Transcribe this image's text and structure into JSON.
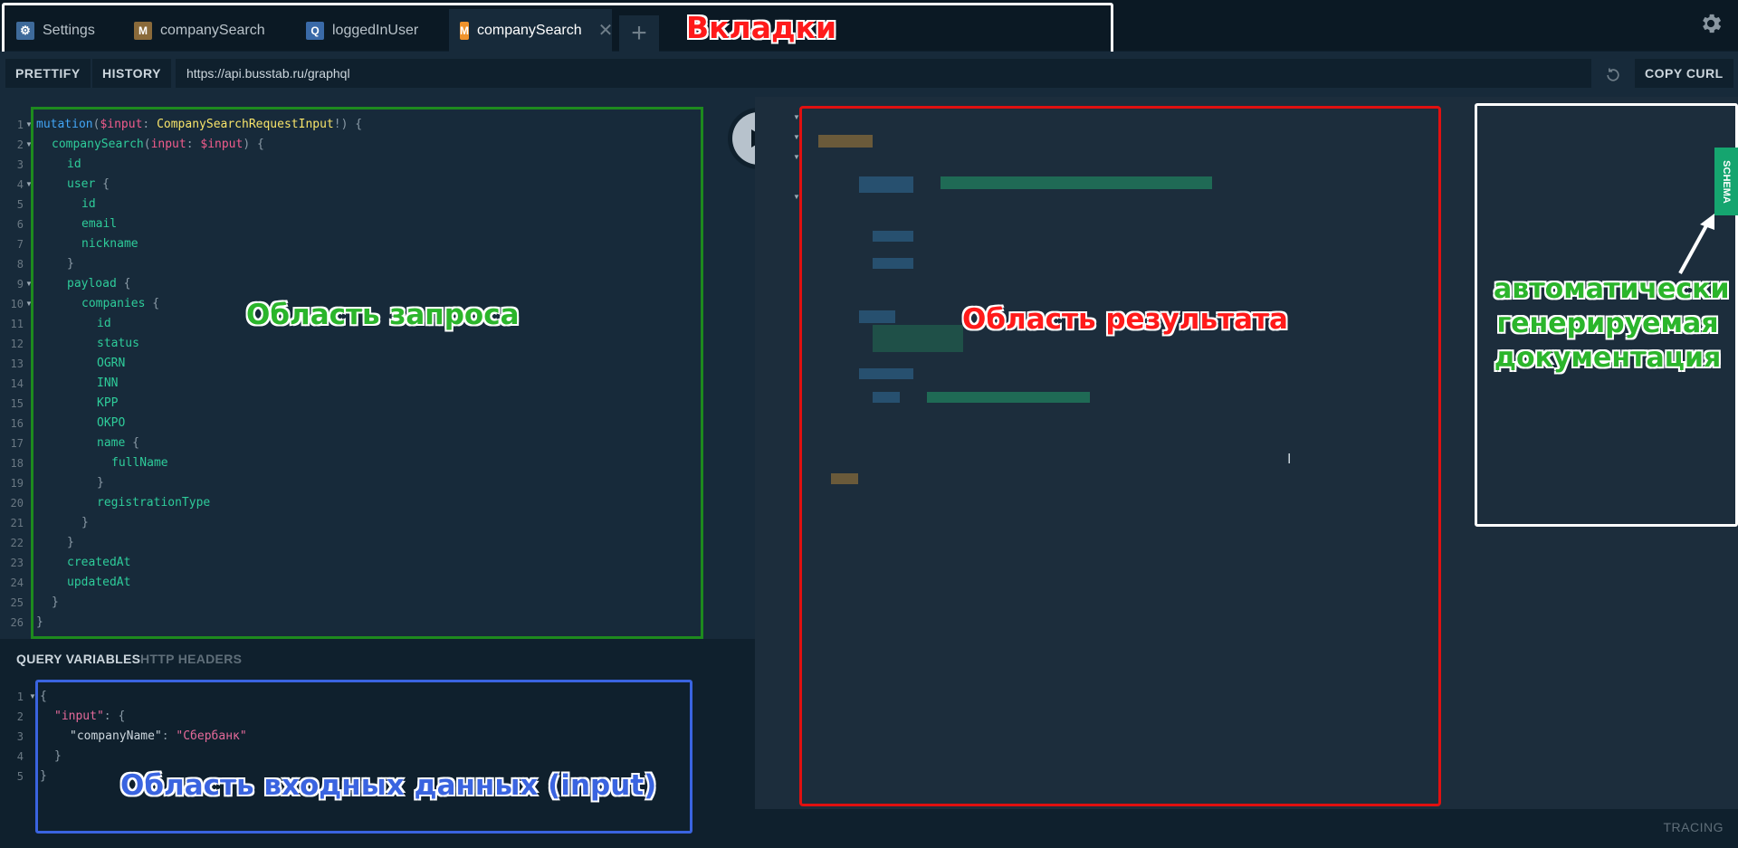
{
  "tabs": [
    {
      "badge": "⚙",
      "label": "Settings",
      "badge_color": "#3e6a9a"
    },
    {
      "badge": "M",
      "label": "companySearch",
      "badge_color": "#8a6a3a"
    },
    {
      "badge": "Q",
      "label": "loggedInUser",
      "badge_color": "#3a6aa8"
    },
    {
      "badge": "M",
      "label": "companySearch",
      "badge_color": "#f0932b",
      "close": "✕"
    }
  ],
  "add_tab": "+",
  "toolbar": {
    "prettify": "PRETTIFY",
    "history": "HISTORY",
    "url": "https://api.busstab.ru/graphql",
    "copy_curl": "COPY CURL"
  },
  "query_lines": [
    "1",
    "2",
    "3",
    "4",
    "5",
    "6",
    "7",
    "8",
    "9",
    "10",
    "11",
    "12",
    "13",
    "14",
    "15",
    "16",
    "17",
    "18",
    "19",
    "20",
    "21",
    "22",
    "23",
    "24",
    "25",
    "26"
  ],
  "query": {
    "l1_kw": "mutation",
    "l1_var": "$input",
    "l1_type": "CompanySearchRequestInput",
    "l2_field": "companySearch",
    "l2_arg": "input",
    "l2_var": "$input",
    "id": "id",
    "user": "user",
    "email": "email",
    "nickname": "nickname",
    "payload": "payload",
    "companies": "companies",
    "status": "status",
    "ogrn": "OGRN",
    "inn": "INN",
    "kpp": "KPP",
    "okpo": "OKPO",
    "name": "name",
    "fullName": "fullName",
    "registrationType": "registrationType",
    "createdAt": "createdAt",
    "updatedAt": "updatedAt"
  },
  "variables_tabs": {
    "query_variables": "QUERY VARIABLES",
    "http_headers": "HTTP HEADERS"
  },
  "variables_lines": [
    "1",
    "2",
    "3",
    "4",
    "5"
  ],
  "variables": {
    "input_key": "\"input\"",
    "company_key": "\"companyName\"",
    "company_value": "\"Сбербанк\""
  },
  "schema_tab": "SCHEMA",
  "tracing": "TRACING",
  "annotations": {
    "tabs": "Вкладки",
    "query_area": "Область запроса",
    "result_area": "Область результата",
    "input_area": "Область входных данных (input)",
    "docs_line1": "автоматически",
    "docs_line2": "генерируемая",
    "docs_line3": "документация"
  },
  "colors": {
    "tabs_box": "#ffffff",
    "query_box": "#1e8a1e",
    "result_box": "#e01010",
    "input_box": "#3a64e0",
    "docs_box": "#ffffff"
  }
}
